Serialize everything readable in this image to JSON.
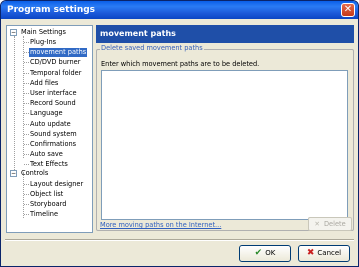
{
  "window": {
    "title": "Program settings",
    "close_glyph": "✕"
  },
  "tree": {
    "main_settings": "Main Settings",
    "main_items": [
      "Plug-Ins",
      "movement paths",
      "CD/DVD  burner",
      "Temporal folder",
      "Add files",
      "User interface",
      "Record Sound",
      "Language",
      "Auto update",
      "Sound system",
      "Confirmations",
      "Auto save",
      "Text Effects"
    ],
    "selected": "movement paths",
    "controls": "Controls",
    "control_items": [
      "Layout designer",
      "Object list",
      "Storyboard",
      "Timeline"
    ],
    "expander_glyph": "−"
  },
  "panel": {
    "header": "movement paths",
    "group_label": "Delete saved movement paths",
    "instruction": "Enter which movement paths are to be deleted.",
    "link": "More moving paths on the Internet...",
    "delete_label": "Delete"
  },
  "footer": {
    "ok_label": "OK",
    "cancel_label": "Cancel",
    "ok_icon": "checkmark-icon",
    "cancel_icon": "x-icon"
  },
  "colors": {
    "title_bar": "#1b58d8",
    "header_bar": "#1f4fa8",
    "selection": "#316ac5"
  }
}
